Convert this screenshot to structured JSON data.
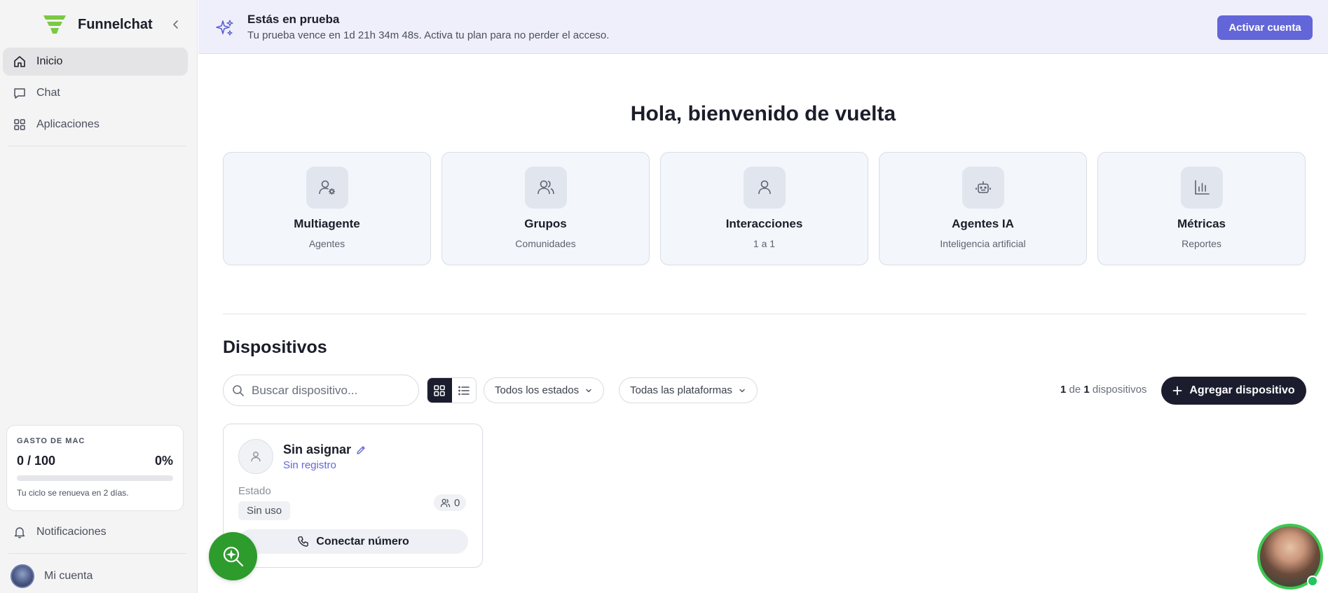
{
  "sidebar": {
    "brand": "Funnelchat",
    "nav": [
      {
        "label": "Inicio",
        "icon": "home-icon",
        "active": true
      },
      {
        "label": "Chat",
        "icon": "chat-icon"
      },
      {
        "label": "Aplicaciones",
        "icon": "apps-grid-icon"
      }
    ],
    "usage": {
      "title": "GASTO DE MAC",
      "value": "0 / 100",
      "percent": "0%",
      "progress": 0,
      "note": "Tu ciclo se renueva en 2 días."
    },
    "notifications": "Notificaciones",
    "account": "Mi cuenta"
  },
  "banner": {
    "title": "Estás en prueba",
    "subtitle": "Tu prueba vence en 1d 21h 34m 48s. Activa tu plan para no perder el acceso.",
    "button": "Activar cuenta"
  },
  "welcome": "Hola, bienvenido de vuelta",
  "cards": [
    {
      "title": "Multiagente",
      "subtitle": "Agentes",
      "icon": "user-gear-icon"
    },
    {
      "title": "Grupos",
      "subtitle": "Comunidades",
      "icon": "users-icon"
    },
    {
      "title": "Interacciones",
      "subtitle": "1 a 1",
      "icon": "user-icon"
    },
    {
      "title": "Agentes IA",
      "subtitle": "Inteligencia artificial",
      "icon": "robot-icon"
    },
    {
      "title": "Métricas",
      "subtitle": "Reportes",
      "icon": "bar-chart-icon"
    }
  ],
  "devices": {
    "title": "Dispositivos",
    "search_placeholder": "Buscar dispositivo...",
    "filter_status": "Todos los estados",
    "filter_platform": "Todas las plataformas",
    "count_shown": "1",
    "count_of": "de",
    "count_total": "1",
    "count_label": "dispositivos",
    "add_button": "Agregar dispositivo",
    "items": [
      {
        "name": "Sin asignar",
        "registration": "Sin registro",
        "state_label": "Estado",
        "state": "Sin uso",
        "members": "0",
        "connect_button": "Conectar número"
      }
    ]
  },
  "colors": {
    "accent": "#6366d8",
    "dark": "#1b1d2f",
    "brand_green": "#7ac943",
    "fab_green": "#2e9b2d"
  }
}
